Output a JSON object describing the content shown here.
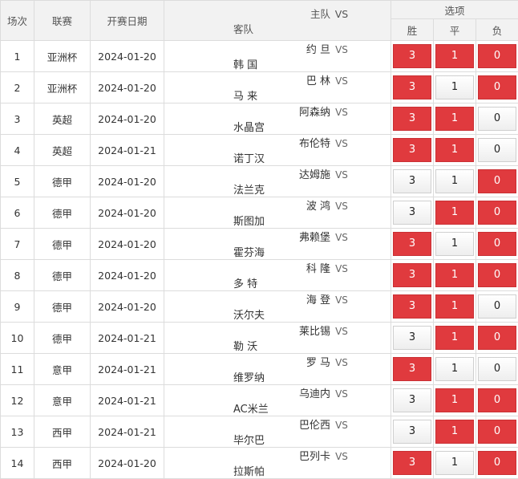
{
  "headers": {
    "round": "场次",
    "league": "联赛",
    "date": "开赛日期",
    "home": "主队",
    "vs": "VS",
    "away": "客队",
    "options": "选项",
    "win": "胜",
    "draw": "平",
    "loss": "负"
  },
  "colors": {
    "selected": "#e03a3e",
    "unselected": "#f0f0f0"
  },
  "matches": [
    {
      "no": "1",
      "league": "亚洲杯",
      "date": "2024-01-20",
      "home": "约 旦",
      "away": "韩 国",
      "w": "3",
      "d": "1",
      "l": "0",
      "sw": true,
      "sd": true,
      "sl": true
    },
    {
      "no": "2",
      "league": "亚洲杯",
      "date": "2024-01-20",
      "home": "巴 林",
      "away": "马 来",
      "w": "3",
      "d": "1",
      "l": "0",
      "sw": true,
      "sd": false,
      "sl": true
    },
    {
      "no": "3",
      "league": "英超",
      "date": "2024-01-20",
      "home": "阿森纳",
      "away": "水晶宫",
      "w": "3",
      "d": "1",
      "l": "0",
      "sw": true,
      "sd": true,
      "sl": false
    },
    {
      "no": "4",
      "league": "英超",
      "date": "2024-01-21",
      "home": "布伦特",
      "away": "诺丁汉",
      "w": "3",
      "d": "1",
      "l": "0",
      "sw": true,
      "sd": true,
      "sl": false
    },
    {
      "no": "5",
      "league": "德甲",
      "date": "2024-01-20",
      "home": "达姆施",
      "away": "法兰克",
      "w": "3",
      "d": "1",
      "l": "0",
      "sw": false,
      "sd": false,
      "sl": true
    },
    {
      "no": "6",
      "league": "德甲",
      "date": "2024-01-20",
      "home": "波 鸿",
      "away": "斯图加",
      "w": "3",
      "d": "1",
      "l": "0",
      "sw": false,
      "sd": true,
      "sl": true
    },
    {
      "no": "7",
      "league": "德甲",
      "date": "2024-01-20",
      "home": "弗赖堡",
      "away": "霍芬海",
      "w": "3",
      "d": "1",
      "l": "0",
      "sw": true,
      "sd": false,
      "sl": true
    },
    {
      "no": "8",
      "league": "德甲",
      "date": "2024-01-20",
      "home": "科 隆",
      "away": "多 特",
      "w": "3",
      "d": "1",
      "l": "0",
      "sw": true,
      "sd": true,
      "sl": true
    },
    {
      "no": "9",
      "league": "德甲",
      "date": "2024-01-20",
      "home": "海 登",
      "away": "沃尔夫",
      "w": "3",
      "d": "1",
      "l": "0",
      "sw": true,
      "sd": true,
      "sl": false
    },
    {
      "no": "10",
      "league": "德甲",
      "date": "2024-01-21",
      "home": "莱比锡",
      "away": "勒 沃",
      "w": "3",
      "d": "1",
      "l": "0",
      "sw": false,
      "sd": true,
      "sl": true
    },
    {
      "no": "11",
      "league": "意甲",
      "date": "2024-01-21",
      "home": "罗 马",
      "away": "维罗纳",
      "w": "3",
      "d": "1",
      "l": "0",
      "sw": true,
      "sd": false,
      "sl": false
    },
    {
      "no": "12",
      "league": "意甲",
      "date": "2024-01-21",
      "home": "乌迪内",
      "away": "AC米兰",
      "w": "3",
      "d": "1",
      "l": "0",
      "sw": false,
      "sd": true,
      "sl": true
    },
    {
      "no": "13",
      "league": "西甲",
      "date": "2024-01-21",
      "home": "巴伦西",
      "away": "毕尔巴",
      "w": "3",
      "d": "1",
      "l": "0",
      "sw": false,
      "sd": true,
      "sl": true
    },
    {
      "no": "14",
      "league": "西甲",
      "date": "2024-01-20",
      "home": "巴列卡",
      "away": "拉斯帕",
      "w": "3",
      "d": "1",
      "l": "0",
      "sw": true,
      "sd": false,
      "sl": true
    }
  ]
}
